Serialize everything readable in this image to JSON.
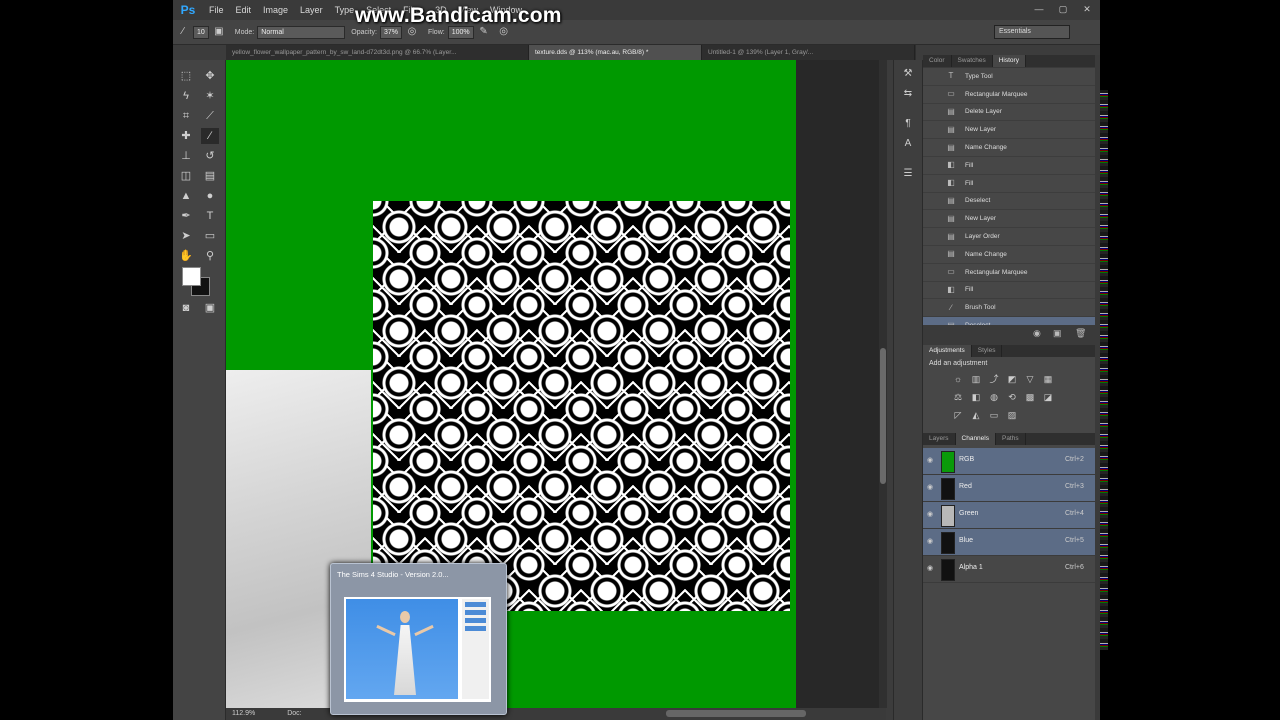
{
  "watermark": "www.Bandicam.com",
  "app": {
    "logo": "Ps"
  },
  "menu": [
    "File",
    "Edit",
    "Image",
    "Layer",
    "Type",
    "Select",
    "Filter",
    "3D",
    "View",
    "Window"
  ],
  "options": {
    "size": "10",
    "mode_label": "Mode:",
    "mode_value": "Normal",
    "opacity_label": "Opacity:",
    "opacity_value": "37%",
    "flow_label": "Flow:",
    "flow_value": "100%",
    "workspace": "Essentials"
  },
  "tabs": [
    "yellow_flower_wallpaper_pattern_by_sw_land-d72dt3d.png @ 66.7% (Layer...",
    "texture.dds @ 113% (mac.au, RGB/8) *",
    "Untitled-1 @ 139% (Layer 1, Gray/..."
  ],
  "status": {
    "zoom": "112.9%",
    "doc": "Doc:"
  },
  "history": {
    "tabs": [
      "Color",
      "Swatches",
      "History"
    ],
    "items": [
      {
        "label": "Type Tool",
        "icon": "T"
      },
      {
        "label": "Rectangular Marquee",
        "icon": "▭"
      },
      {
        "label": "Delete Layer",
        "icon": "▤"
      },
      {
        "label": "New Layer",
        "icon": "▤"
      },
      {
        "label": "Name Change",
        "icon": "▤"
      },
      {
        "label": "Fill",
        "icon": "◧"
      },
      {
        "label": "Fill",
        "icon": "◧"
      },
      {
        "label": "Deselect",
        "icon": "▤"
      },
      {
        "label": "New Layer",
        "icon": "▤"
      },
      {
        "label": "Layer Order",
        "icon": "▤"
      },
      {
        "label": "Name Change",
        "icon": "▤"
      },
      {
        "label": "Rectangular Marquee",
        "icon": "▭"
      },
      {
        "label": "Fill",
        "icon": "◧"
      },
      {
        "label": "Brush Tool",
        "icon": "∕"
      },
      {
        "label": "Deselect",
        "icon": "▤"
      }
    ],
    "selected_index": 14
  },
  "adjustments": {
    "tabs": [
      "Adjustments",
      "Styles"
    ],
    "title": "Add an adjustment"
  },
  "channels": {
    "tabs": [
      "Layers",
      "Channels",
      "Paths"
    ],
    "rows": [
      {
        "name": "RGB",
        "shortcut": "Ctrl+2",
        "thumb": "#0a9a0a",
        "selected": true
      },
      {
        "name": "Red",
        "shortcut": "Ctrl+3",
        "thumb": "#111111",
        "selected": true
      },
      {
        "name": "Green",
        "shortcut": "Ctrl+4",
        "thumb": "#b8b8b8",
        "selected": true
      },
      {
        "name": "Blue",
        "shortcut": "Ctrl+5",
        "thumb": "#111111",
        "selected": true
      },
      {
        "name": "Alpha 1",
        "shortcut": "Ctrl+6",
        "thumb": "#111111",
        "selected": false
      }
    ]
  },
  "preview": {
    "title": "The Sims 4 Studio - Version 2.0..."
  }
}
